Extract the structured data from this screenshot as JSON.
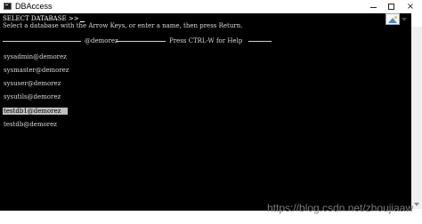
{
  "window": {
    "title": "DBAccess",
    "minimize_label": "—",
    "maximize_label": "",
    "close_label": "×"
  },
  "console": {
    "prompt_line": "SELECT DATABASE >>",
    "instruction_line": "Select a database with the Arrow Keys, or enter a name, then press Return.",
    "header_server": "@demorez",
    "header_help": "Press CTRL-W for Help",
    "databases": [
      {
        "name": "sysadmin@demorez",
        "selected": false
      },
      {
        "name": "sysmaster@demorez",
        "selected": false
      },
      {
        "name": "sysuser@demorez",
        "selected": false
      },
      {
        "name": "sysutils@demorez",
        "selected": false
      },
      {
        "name": "testdb1@demorez",
        "selected": true
      },
      {
        "name": "testdb@demorez",
        "selected": false
      }
    ]
  },
  "overlay": {
    "image_icon": "image-icon",
    "watermark": "https://blog.csdn.net/zhoujiaaw"
  },
  "colors": {
    "console_bg": "#000000",
    "console_text": "#d8d8d8",
    "selection_bg": "#c0c0c0"
  }
}
